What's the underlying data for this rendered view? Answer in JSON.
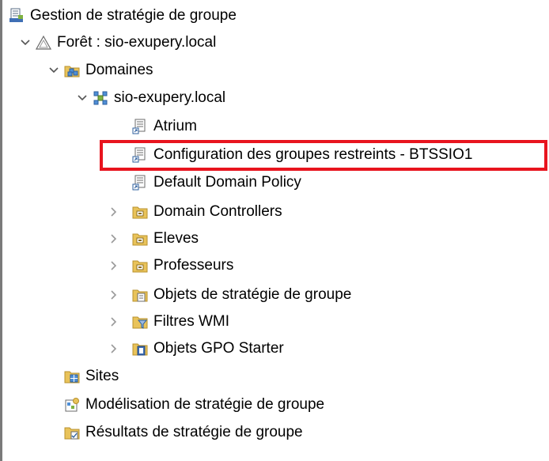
{
  "tree": {
    "root": {
      "label": "Gestion de stratégie de groupe",
      "icon": "gpmc-console-icon"
    },
    "forest": {
      "label": "Forêt : sio-exupery.local",
      "icon": "forest-icon",
      "expanded": true
    },
    "domains": {
      "label": "Domaines",
      "icon": "domains-folder-icon",
      "expanded": true
    },
    "domain": {
      "label": "sio-exupery.local",
      "icon": "domain-icon",
      "expanded": true
    },
    "domain_children": [
      {
        "label": "Atrium",
        "icon": "gpo-link-icon",
        "has_toggle": false
      },
      {
        "label": "Configuration des groupes restreints - BTSSIO1",
        "icon": "gpo-link-icon",
        "has_toggle": false,
        "highlighted": true
      },
      {
        "label": "Default Domain Policy",
        "icon": "gpo-link-icon",
        "has_toggle": false
      },
      {
        "label": "Domain Controllers",
        "icon": "ou-folder-icon",
        "has_toggle": true
      },
      {
        "label": "Eleves",
        "icon": "ou-folder-icon",
        "has_toggle": true
      },
      {
        "label": "Professeurs",
        "icon": "ou-folder-icon",
        "has_toggle": true
      },
      {
        "label": "Objets de stratégie de groupe",
        "icon": "gpo-container-icon",
        "has_toggle": true
      },
      {
        "label": "Filtres WMI",
        "icon": "wmi-filter-icon",
        "has_toggle": true
      },
      {
        "label": "Objets GPO Starter",
        "icon": "starter-gpo-icon",
        "has_toggle": true
      }
    ],
    "sites": {
      "label": "Sites",
      "icon": "sites-icon"
    },
    "modeling": {
      "label": "Modélisation de stratégie de groupe",
      "icon": "modeling-icon"
    },
    "results": {
      "label": "Résultats de stratégie de groupe",
      "icon": "results-icon"
    }
  },
  "colors": {
    "highlight_border": "#e8141e",
    "left_border": "#7a7a7a",
    "chevron": "#555555"
  }
}
